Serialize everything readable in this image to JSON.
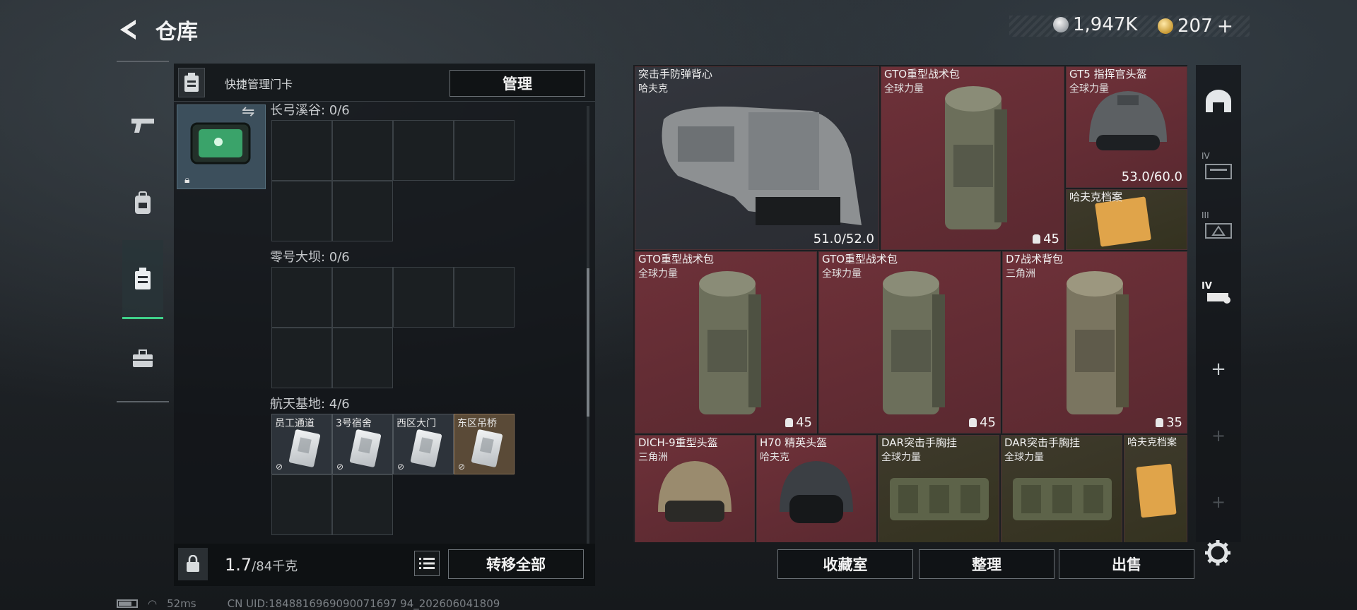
{
  "header": {
    "title": "仓库"
  },
  "currency": {
    "coins": "1,947K",
    "premium": "207"
  },
  "left_panel": {
    "quick_label": "快捷管理门卡",
    "manage_button": "管理",
    "sections": [
      {
        "label": "长弓溪谷: 0/6"
      },
      {
        "label": "零号大坝: 0/6"
      },
      {
        "label": "航天基地: 4/6"
      }
    ],
    "keycards": [
      {
        "name": "员工通道",
        "style": "gray"
      },
      {
        "name": "3号宿舍",
        "style": "gray"
      },
      {
        "name": "西区大门",
        "style": "gray"
      },
      {
        "name": "东区吊桥",
        "style": "gold"
      }
    ],
    "weight": {
      "value": "1.7",
      "unit": "/84千克"
    },
    "transfer_all_button": "转移全部"
  },
  "stash": {
    "items": [
      {
        "name": "突击手防弹背心",
        "sub": "哈夫克",
        "value": "51.0/52.0",
        "kind": "durability",
        "style": "gray",
        "icon": "armor-vest"
      },
      {
        "name": "GTO重型战术包",
        "sub": "全球力量",
        "value": "45",
        "kind": "capacity",
        "style": "red",
        "icon": "backpack"
      },
      {
        "name": "GT5 指挥官头盔",
        "sub": "全球力量",
        "value": "53.0/60.0",
        "kind": "durability",
        "style": "red",
        "icon": "helmet"
      },
      {
        "name": "哈夫克档案",
        "sub": "",
        "value": "",
        "kind": "none",
        "style": "olive",
        "icon": "document"
      },
      {
        "name": "GTO重型战术包",
        "sub": "全球力量",
        "value": "45",
        "kind": "capacity",
        "style": "red",
        "icon": "backpack"
      },
      {
        "name": "GTO重型战术包",
        "sub": "全球力量",
        "value": "45",
        "kind": "capacity",
        "style": "red",
        "icon": "backpack"
      },
      {
        "name": "D7战术背包",
        "sub": "三角洲",
        "value": "35",
        "kind": "capacity",
        "style": "red",
        "icon": "backpack"
      },
      {
        "name": "DICH-9重型头盔",
        "sub": "三角洲",
        "value": "",
        "kind": "none",
        "style": "red",
        "icon": "helmet"
      },
      {
        "name": "H70 精英头盔",
        "sub": "哈夫克",
        "value": "",
        "kind": "none",
        "style": "red",
        "icon": "helmet"
      },
      {
        "name": "DAR突击手胸挂",
        "sub": "全球力量",
        "value": "",
        "kind": "none",
        "style": "olive",
        "icon": "chest-rig"
      },
      {
        "name": "DAR突击手胸挂",
        "sub": "全球力量",
        "value": "",
        "kind": "none",
        "style": "olive",
        "icon": "chest-rig"
      },
      {
        "name": "哈夫克档案",
        "sub": "",
        "value": "",
        "kind": "none",
        "style": "olive",
        "icon": "document"
      }
    ]
  },
  "right_rail": {
    "tier_a": "IV",
    "tier_b": "III",
    "tier_c": "IV"
  },
  "footer": {
    "collection_button": "收藏室",
    "sort_button": "整理",
    "sell_button": "出售"
  },
  "status_bar": {
    "ping": "52ms",
    "uid": "CN UID:1848816969090071697 94_202606041809"
  },
  "colors": {
    "accent": "#3fd18a",
    "tile_red": "#6e3139",
    "tile_gray": "#33363d"
  }
}
